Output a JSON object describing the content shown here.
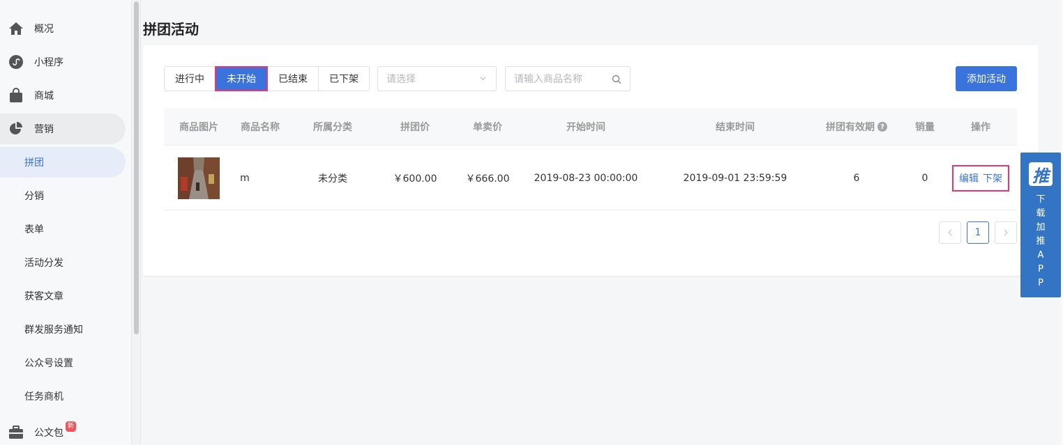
{
  "sidebar": {
    "items": [
      {
        "label": "概况",
        "icon": "home-icon"
      },
      {
        "label": "小程序",
        "icon": "miniprogram-icon"
      },
      {
        "label": "商城",
        "icon": "shopping-bag-icon"
      },
      {
        "label": "营销",
        "icon": "pie-chart-icon"
      },
      {
        "label": "拼团"
      },
      {
        "label": "分销"
      },
      {
        "label": "表单"
      },
      {
        "label": "活动分发"
      },
      {
        "label": "获客文章"
      },
      {
        "label": "群发服务通知"
      },
      {
        "label": "公众号设置"
      },
      {
        "label": "任务商机"
      },
      {
        "label": "公文包",
        "icon": "briefcase-icon",
        "badge": "新"
      }
    ]
  },
  "page": {
    "title": "拼团活动"
  },
  "filters": {
    "tabs": [
      "进行中",
      "未开始",
      "已结束",
      "已下架"
    ],
    "active_tab": "未开始",
    "select_placeholder": "请选择",
    "search_placeholder": "请输入商品名称",
    "add_button": "添加活动"
  },
  "table": {
    "headers": [
      "商品图片",
      "商品名称",
      "所属分类",
      "拼团价",
      "单卖价",
      "开始时间",
      "结束时间",
      "拼团有效期",
      "销量",
      "操作"
    ],
    "rows": [
      {
        "name": "m",
        "category": "未分类",
        "group_price": "￥600.00",
        "single_price": "￥666.00",
        "start_time": "2019-08-23 00:00:00",
        "end_time": "2019-09-01 23:59:59",
        "validity": "6",
        "sales": "0",
        "actions": [
          "编辑",
          "下架"
        ]
      }
    ]
  },
  "pagination": {
    "current": "1"
  },
  "app_float": {
    "logo": "推",
    "text": [
      "下",
      "载",
      "加",
      "推",
      "A",
      "P",
      "P"
    ]
  },
  "colors": {
    "primary": "#3a73db",
    "highlight": "#f0336e",
    "float_bg": "#3374c5"
  }
}
